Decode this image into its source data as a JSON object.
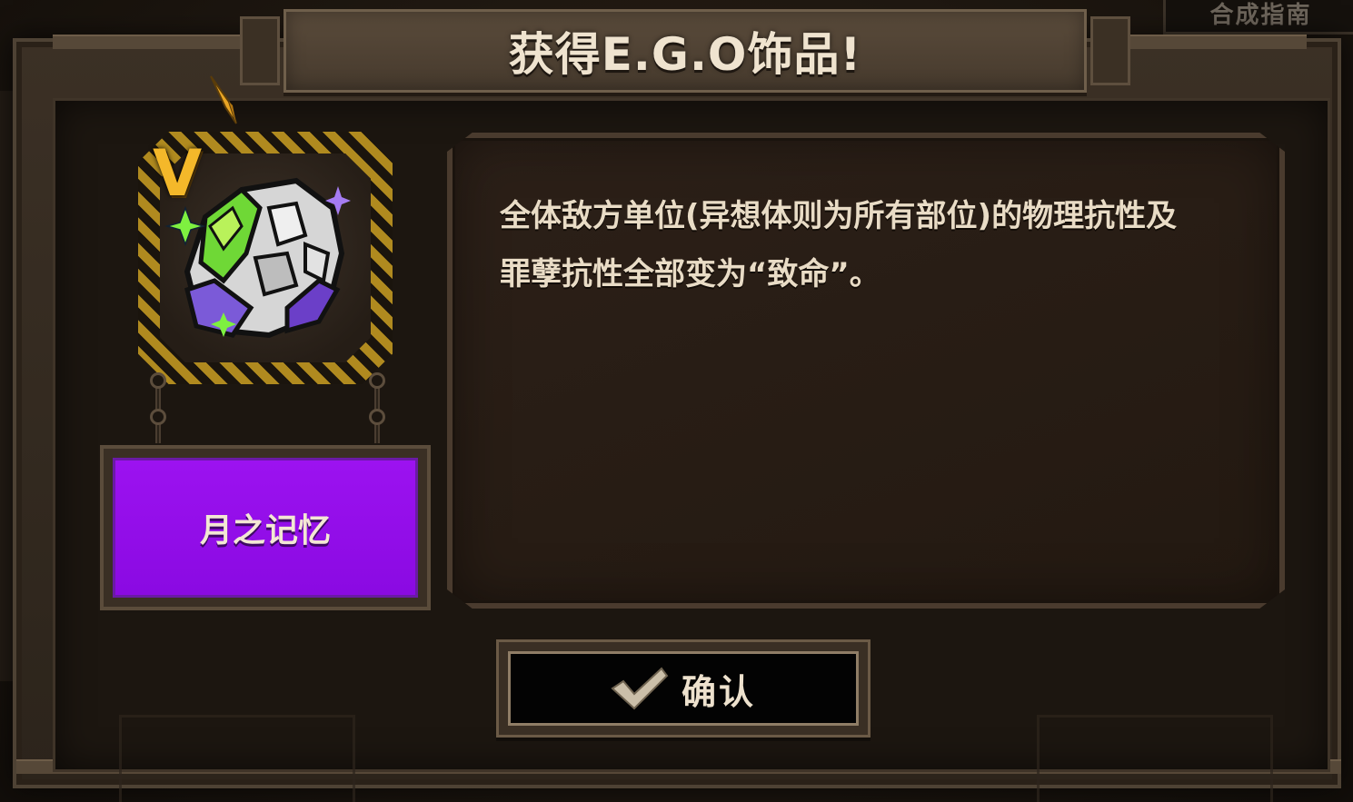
{
  "background": {
    "guide_tab": "合成指南"
  },
  "modal": {
    "title": "获得E.G.O饰品!",
    "item": {
      "rank": "V",
      "name": "月之记忆",
      "icon": "moon-memory-rock-icon",
      "name_plate_color": "#9c12f0",
      "rank_color": "#f4b82a"
    },
    "description_lines": [
      "全体敌方单位(异想体则为所有部位)的物理抗性及",
      "罪孽抗性全部变为“致命”。"
    ],
    "confirm": {
      "icon": "checkmark-icon",
      "label": "确认"
    }
  }
}
